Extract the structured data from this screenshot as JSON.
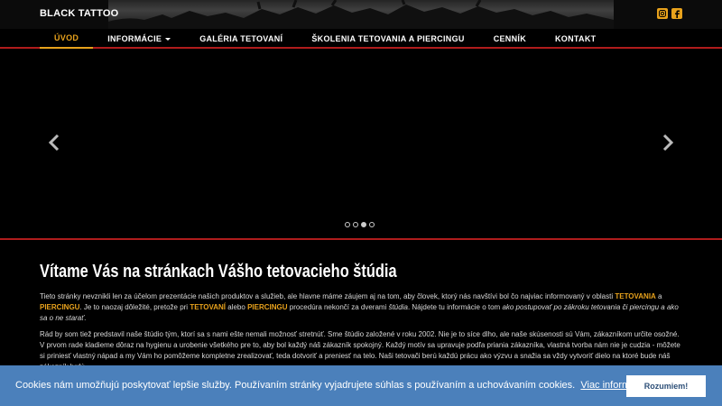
{
  "header": {
    "brand": "BLACK TATTOO",
    "social": [
      {
        "icon": "instagram-icon",
        "color": "#e8a21c"
      },
      {
        "icon": "facebook-icon",
        "color": "#e8a21c"
      }
    ]
  },
  "nav": {
    "items": [
      {
        "label": "ÚVOD",
        "active": true
      },
      {
        "label": "INFORMÁCIE",
        "has_dropdown": true
      },
      {
        "label": "GALÉRIA TETOVANÍ"
      },
      {
        "label": "ŠKOLENIA TETOVANIA A PIERCINGU"
      },
      {
        "label": "CENNÍK"
      },
      {
        "label": "KONTAKT"
      }
    ]
  },
  "slider": {
    "prev_icon": "chevron-left-icon",
    "next_icon": "chevron-right-icon",
    "slide_count": 4,
    "active_slide": 3
  },
  "content": {
    "title": "Vítame Vás na stránkach Vášho tetovacieho štúdia",
    "p1": {
      "t1": "Tieto stránky nevznikli len za účelom prezentácie našich produktov a služieb, ale hlavne máme záujem aj na tom, aby človek, ktorý nás navštívi bol čo najviac informovaný v oblasti ",
      "b1": "TETOVANIA",
      "t2": " a ",
      "b2": "PIERCINGU",
      "t3": ". Je to naozaj dôležité, pretože pri ",
      "b3": "TETOVANÍ",
      "t4": " alebo ",
      "b4": "PIERCINGU",
      "t5": " procedúra nekončí za dverami ",
      "i1": "štúdia",
      "t6": ". Nájdete tu informácie o tom ",
      "i2": "ako postupovať po zákroku tetovania či piercingu a ako sa o ne starať",
      "t7": "."
    },
    "p2": "Rád by som tiež predstavil naše štúdio tým, ktorí sa s nami ešte nemali možnosť stretnúť. Sme štúdio založené v roku 2002. Nie je to síce dlho, ale naše skúsenosti sú Vám, zákazníkom určite osožné. V prvom rade kladieme dôraz na hygienu a urobenie všetkého pre to, aby bol každý náš zákazník spokojný. Každý motív sa upravuje podľa priania zákazníka, vlastná tvorba nám nie je cudzia - môžete si priniesť vlastný nápad a my Vám ho pomôžeme kompletne zrealizovať, teda dotvoriť a preniesť na telo. Naši tetovači berú každú prácu ako výzvu a snažia sa vždy vytvoriť dielo na ktoré bude náš zákazník hrdý."
  },
  "cookie": {
    "text": "Cookies nám umožňujú poskytovať lepšie služby. Používaním stránky vyjadrujete súhlas s používaním a uchovávaním cookies.",
    "link": "Viac informácií",
    "button": "Rozumiem!"
  }
}
